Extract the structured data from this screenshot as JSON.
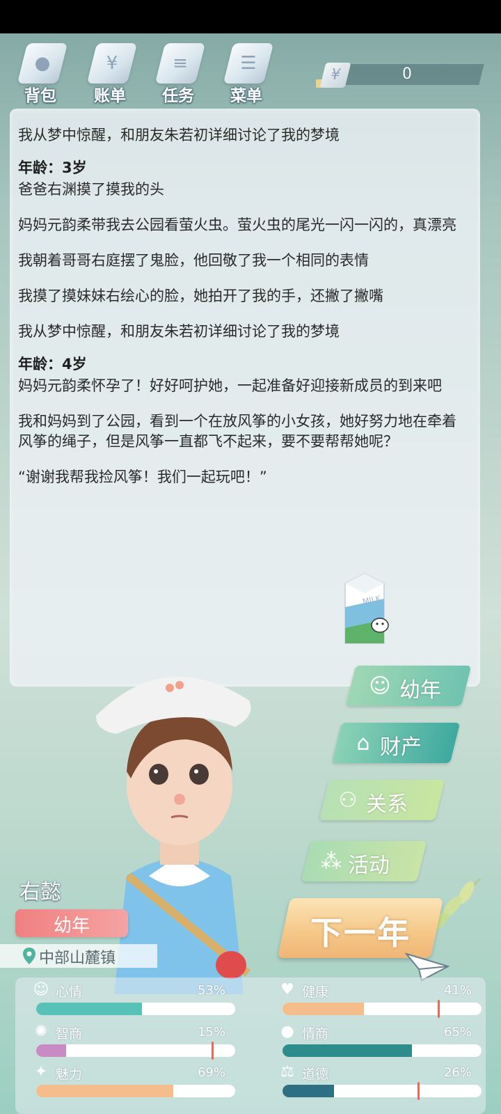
{
  "topnav": {
    "items": [
      {
        "label": "背包",
        "icon": "bag-icon"
      },
      {
        "label": "账单",
        "icon": "bill-icon"
      },
      {
        "label": "任务",
        "icon": "task-icon"
      },
      {
        "label": "菜单",
        "icon": "menu-icon"
      }
    ],
    "money": {
      "symbol": "¥",
      "value": "0"
    }
  },
  "log": {
    "entries": [
      {
        "type": "text",
        "text": "我从梦中惊醒，和朋友朱若初详细讨论了我的梦境"
      },
      {
        "type": "age",
        "text": "年龄：3岁"
      },
      {
        "type": "text",
        "text": "爸爸右渊摸了摸我的头"
      },
      {
        "type": "text",
        "text": "妈妈元韵柔带我去公园看萤火虫。萤火虫的尾光一闪一闪的，真漂亮"
      },
      {
        "type": "text",
        "text": "我朝着哥哥右庭摆了鬼脸，他回敬了我一个相同的表情"
      },
      {
        "type": "text",
        "text": "我摸了摸妹妹右绘心的脸，她拍开了我的手，还撇了撇嘴"
      },
      {
        "type": "text",
        "text": "我从梦中惊醒，和朋友朱若初详细讨论了我的梦境"
      },
      {
        "type": "age",
        "text": "年龄：4岁"
      },
      {
        "type": "text",
        "text": "妈妈元韵柔怀孕了！好好呵护她，一起准备好迎接新成员的到来吧"
      },
      {
        "type": "text",
        "text": "我和妈妈到了公园，看到一个在放风筝的小女孩，她好努力地在牵着风筝的绳子，但是风筝一直都飞不起来，要不要帮帮她呢？"
      },
      {
        "type": "text",
        "text": "“谢谢我帮我捡风筝！我们一起玩吧！”"
      }
    ],
    "milk_label": "MILK"
  },
  "side_menu": {
    "stage": "幼年",
    "assets": "财产",
    "relations": "关系",
    "activity": "活动"
  },
  "next_year": "下一年",
  "character": {
    "name": "右懿",
    "stage": "幼年",
    "location": "中部山麓镇"
  },
  "stats": [
    {
      "name": "心情",
      "icon": "smile-icon",
      "glyph": "☺",
      "percent": 53,
      "display": "53%",
      "color": "#58c2b8",
      "marker": null
    },
    {
      "name": "健康",
      "icon": "heart-icon",
      "glyph": "♥",
      "percent": 41,
      "display": "41%",
      "color": "#f6bd8c",
      "marker": 0.78
    },
    {
      "name": "智商",
      "icon": "brain-icon",
      "glyph": "✺",
      "percent": 15,
      "display": "15%",
      "color": "#c98bc4",
      "marker": 0.88
    },
    {
      "name": "情商",
      "icon": "apple-icon",
      "glyph": "●",
      "percent": 65,
      "display": "65%",
      "color": "#2e8d8c",
      "marker": null
    },
    {
      "name": "魅力",
      "icon": "sparkle-icon",
      "glyph": "✦",
      "percent": 69,
      "display": "69%",
      "color": "#f6bd8c",
      "marker": null
    },
    {
      "name": "道德",
      "icon": "scale-icon",
      "glyph": "⚖",
      "percent": 26,
      "display": "26%",
      "color": "#2e6f84",
      "marker": 0.68
    }
  ],
  "colors": {
    "stage_pill": "#f08080",
    "menu_green": "#6fc3b0",
    "next_year": "#f5c98a"
  }
}
